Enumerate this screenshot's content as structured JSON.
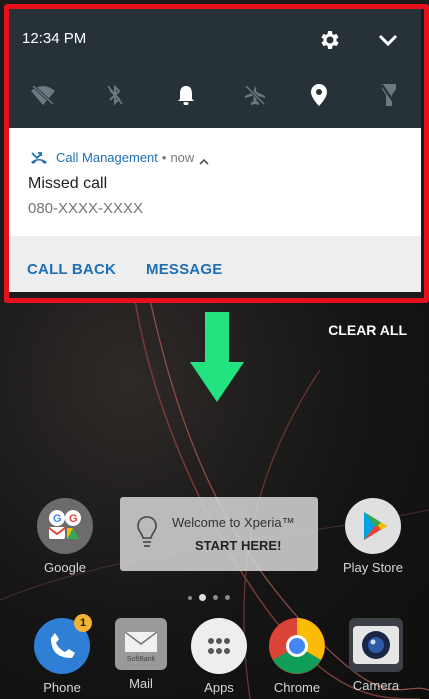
{
  "status": {
    "time": "12:34 PM"
  },
  "quick_settings": {
    "icons": [
      "gear-icon",
      "chevron-down-icon"
    ],
    "tiles": [
      "wifi-off-icon",
      "bluetooth-off-icon",
      "bell-icon",
      "airplane-off-icon",
      "location-icon",
      "flashlight-off-icon"
    ]
  },
  "notification": {
    "app_name": "Call Management",
    "separator": "•",
    "when": "now",
    "title": "Missed call",
    "number": "080-XXXX-XXXX",
    "actions": {
      "call_back": "CALL BACK",
      "message": "MESSAGE"
    }
  },
  "colors": {
    "highlight": "#e8101d",
    "accent": "#1e6fb3",
    "arrow": "#22e37f"
  },
  "home": {
    "clear_all": "CLEAR ALL",
    "welcome_line1": "Welcome to Xperia™",
    "welcome_line2": "START HERE!",
    "apps_top": {
      "google": "Google",
      "play_store": "Play Store"
    },
    "dock": {
      "phone": "Phone",
      "mail": "Mail",
      "apps": "Apps",
      "chrome": "Chrome",
      "camera": "Camera"
    },
    "phone_badge": "1",
    "mail_small_text": "SoftBank"
  }
}
